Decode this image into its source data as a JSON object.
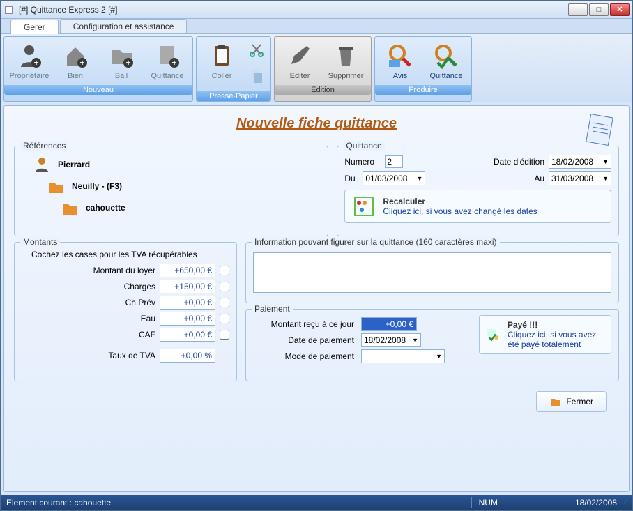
{
  "window": {
    "title": "[#] Quittance Express 2  [#]"
  },
  "win_buttons": {
    "min": "_",
    "max": "□",
    "close": "✕"
  },
  "tabs": {
    "gerer": "Gerer",
    "config": "Configuration et assistance"
  },
  "ribbon": {
    "nouveau": {
      "label": "Nouveau",
      "proprietaire": "Propriétaire",
      "bien": "Bien",
      "bail": "Bail",
      "quittance": "Quittance"
    },
    "presse": {
      "label": "Presse-Papier",
      "coller": "Coller"
    },
    "edition": {
      "label": "Edition",
      "editer": "Editer",
      "supprimer": "Supprimer"
    },
    "produire": {
      "label": "Produire",
      "avis": "Avis",
      "quittance": "Quittance"
    }
  },
  "page_title": "Nouvelle fiche quittance",
  "references": {
    "legend": "Références",
    "pierrard": "Pierrard",
    "neuilly": "Neuilly  -  (F3)",
    "cahouette": "cahouette"
  },
  "quittance": {
    "legend": "Quittance",
    "numero_label": "Numero",
    "numero_value": "2",
    "edition_label": "Date d'édition",
    "edition_value": "18/02/2008",
    "du_label": "Du",
    "du_value": "01/03/2008",
    "au_label": "Au",
    "au_value": "31/03/2008",
    "recalc_title": "Recalculer",
    "recalc_link": "Cliquez ici, si vous avez changé les dates"
  },
  "montants": {
    "legend": "Montants",
    "hint": "Cochez les cases pour les TVA récupérables",
    "loyer_label": "Montant du loyer",
    "loyer_value": "+650,00 €",
    "charges_label": "Charges",
    "charges_value": "+150,00 €",
    "chprev_label": "Ch.Prév",
    "chprev_value": "+0,00 €",
    "eau_label": "Eau",
    "eau_value": "+0,00 €",
    "caf_label": "CAF",
    "caf_value": "+0,00 €",
    "tva_label": "Taux de TVA",
    "tva_value": "+0,00 %"
  },
  "information": {
    "legend": "Information pouvant figurer sur la quittance (160 caractères maxi)"
  },
  "paiement": {
    "legend": "Paiement",
    "montant_label": "Montant reçu à ce jour",
    "montant_value": "+0,00 €",
    "date_label": "Date de paiement",
    "date_value": "18/02/2008",
    "mode_label": "Mode de paiement",
    "paid_title": "Payé !!!",
    "paid_link": "Cliquez ici, si vous avez été payé  totalement"
  },
  "close_button": "Fermer",
  "statusbar": {
    "left": "Element courant : cahouette",
    "num": "NUM",
    "date": "18/02/2008"
  }
}
